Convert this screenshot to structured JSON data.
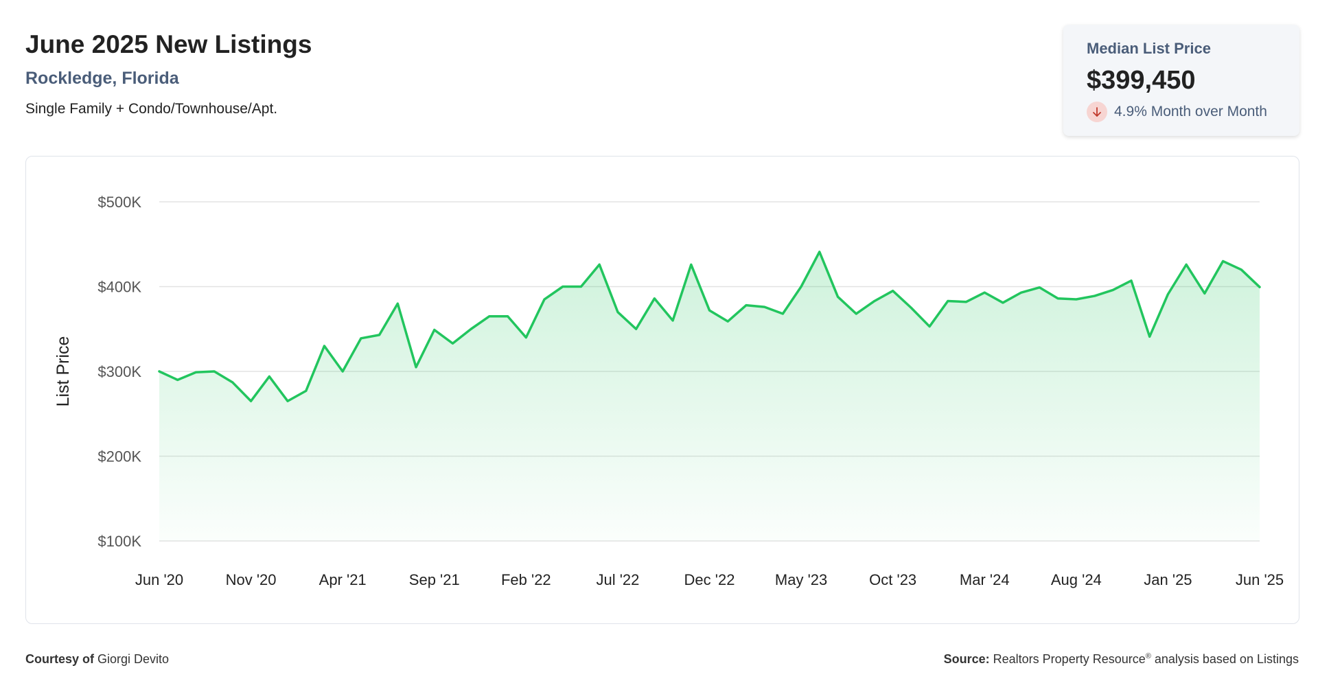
{
  "header": {
    "title": "June 2025 New Listings",
    "location": "Rockledge, Florida",
    "property_types": "Single Family + Condo/Townhouse/Apt."
  },
  "stat_card": {
    "label": "Median List Price",
    "value": "$399,450",
    "change": "4.9% Month over Month",
    "direction_icon": "arrow-down-icon"
  },
  "footer": {
    "courtesy_label": "Courtesy of",
    "courtesy_name": "Giorgi Devito",
    "source_label": "Source:",
    "source_text": "Realtors Property Resource",
    "source_mark": "®",
    "source_suffix": "analysis based on Listings"
  },
  "colors": {
    "line": "#22c55e",
    "fill_top": "#22c55e",
    "grid": "#e3e3e3",
    "title_secondary": "#4a5d79",
    "down_badge": "#f7d5d2",
    "down_arrow": "#c0392b"
  },
  "chart_data": {
    "type": "area",
    "ylabel": "List Price",
    "xlabel": "",
    "ylim": [
      100000,
      500000
    ],
    "yticks": [
      100000,
      200000,
      300000,
      400000,
      500000
    ],
    "ytick_labels": [
      "$100K",
      "$200K",
      "$300K",
      "$400K",
      "$500K"
    ],
    "xtick_labels": [
      "Jun '20",
      "Nov '20",
      "Apr '21",
      "Sep '21",
      "Feb '22",
      "Jul '22",
      "Dec '22",
      "May '23",
      "Oct '23",
      "Mar '24",
      "Aug '24",
      "Jan '25",
      "Jun '25"
    ],
    "xtick_indices": [
      0,
      5,
      10,
      15,
      20,
      25,
      30,
      35,
      40,
      45,
      50,
      55,
      60
    ],
    "grid": true,
    "legend": "none",
    "series": [
      {
        "values": [
          300000,
          290000,
          299000,
          300000,
          287000,
          265000,
          294000,
          265000,
          277000,
          330000,
          300000,
          339000,
          343000,
          380000,
          305000,
          349000,
          333000,
          350000,
          365000,
          365000,
          340000,
          385000,
          400000,
          400000,
          426000,
          370000,
          350000,
          386000,
          360000,
          426000,
          372000,
          359000,
          378000,
          376000,
          368000,
          400000,
          441000,
          388000,
          368000,
          383000,
          395000,
          375000,
          353000,
          383000,
          382000,
          393000,
          381000,
          393000,
          399000,
          386000,
          385000,
          389000,
          396000,
          407000,
          341000,
          391000,
          426000,
          392000,
          430000,
          420000,
          399450
        ]
      }
    ]
  }
}
